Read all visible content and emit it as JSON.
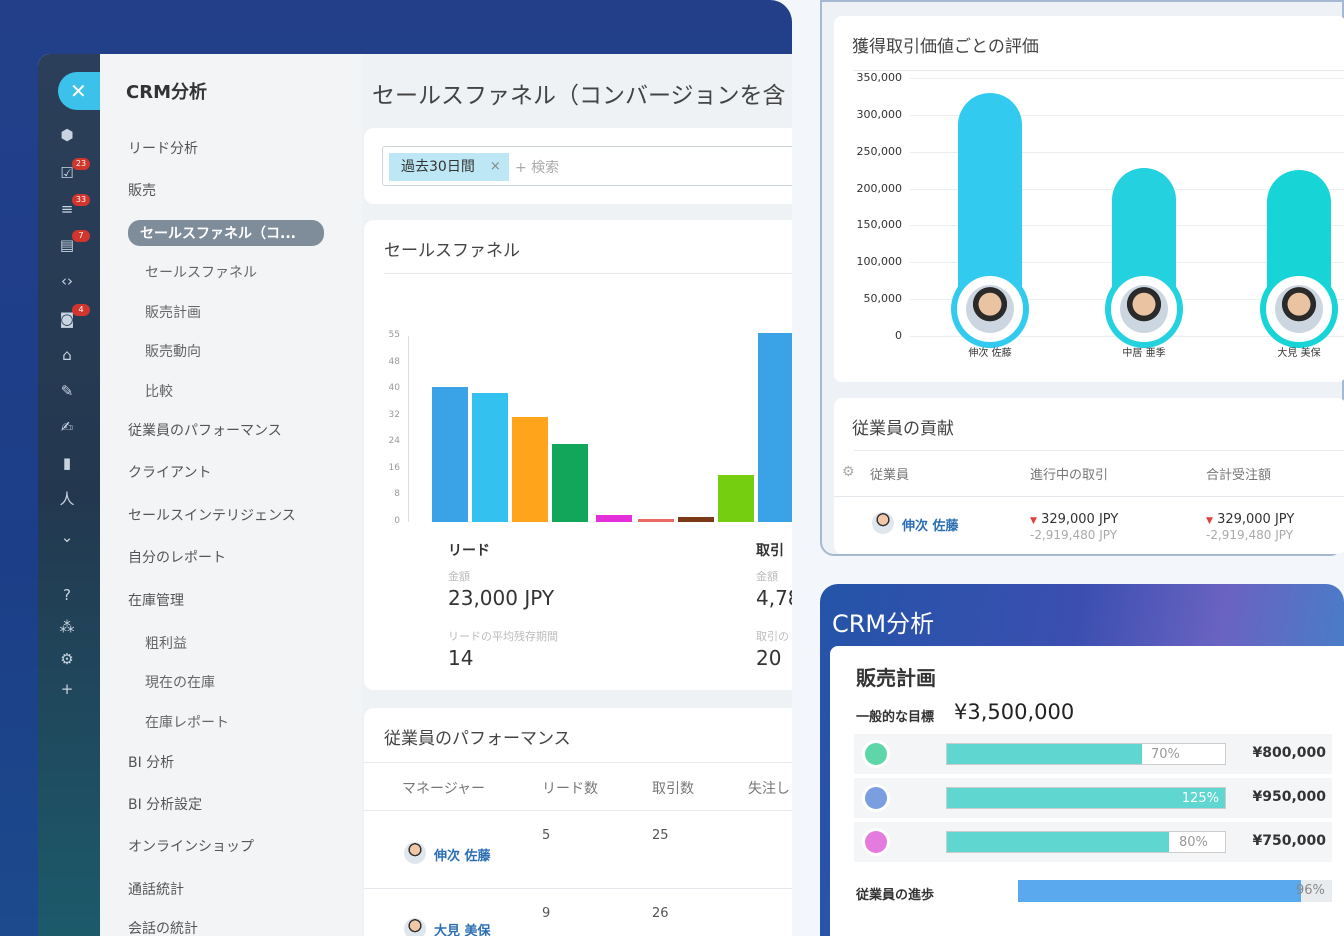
{
  "menu": {
    "title": "CRM分析",
    "items": [
      {
        "label": "リード分析"
      },
      {
        "label": "販売"
      },
      {
        "label": "セールスファネル（コ..."
      },
      {
        "label": "セールスファネル"
      },
      {
        "label": "販売計画"
      },
      {
        "label": "販売動向"
      },
      {
        "label": "比較"
      },
      {
        "label": "従業員のパフォーマンス"
      },
      {
        "label": "クライアント"
      },
      {
        "label": "セールスインテリジェンス"
      },
      {
        "label": "自分のレポート"
      },
      {
        "label": "在庫管理"
      },
      {
        "label": "粗利益"
      },
      {
        "label": "現在の在庫"
      },
      {
        "label": "在庫レポート"
      },
      {
        "label": "BI 分析"
      },
      {
        "label": "BI 分析設定"
      },
      {
        "label": "オンラインショップ"
      },
      {
        "label": "通話統計"
      },
      {
        "label": "会話の統計"
      }
    ]
  },
  "iconbar": {
    "close_icon": "✕",
    "badges": [
      "23",
      "33",
      "7",
      "4"
    ]
  },
  "main": {
    "title": "セールスファネル（コンバージョンを含",
    "filter": {
      "chip": "過去30日間",
      "chip_close": "×",
      "search_placeholder": "+ 検索"
    },
    "funnel": {
      "title": "セールスファネル",
      "leads": {
        "label": "リード",
        "amount_label": "金額",
        "amount": "23,000 JPY",
        "avg_label": "リードの平均残存期間",
        "avg": "14"
      },
      "deals": {
        "label": "取引",
        "amount_label": "金額",
        "amount": "4,78",
        "avg_label": "取引の",
        "avg": "20"
      }
    },
    "performance": {
      "title": "従業員のパフォーマンス",
      "columns": [
        "マネージャー",
        "リード数",
        "取引数",
        "失注し"
      ],
      "rows": [
        {
          "name": "伸次 佐藤",
          "leads": "5",
          "deals": "25"
        },
        {
          "name": "大見 美保",
          "leads": "9",
          "deals": "26"
        }
      ]
    }
  },
  "chart_data": [
    {
      "type": "bar",
      "ylim": [
        0,
        55
      ],
      "yticks": [
        "55",
        "48",
        "40",
        "32",
        "24",
        "16",
        "8",
        "0"
      ],
      "values": [
        40,
        38,
        31,
        23,
        2,
        1,
        1.5,
        14,
        56
      ],
      "colors": [
        "#3aa3e8",
        "#33c1f0",
        "#ffa41b",
        "#12a65b",
        "#e52fdb",
        "#e96b63",
        "#7a3a18",
        "#75cf10",
        "#3aa3e8"
      ]
    },
    {
      "type": "bar",
      "title": "獲得取引価値ごとの評価",
      "ylim": [
        0,
        350000
      ],
      "yticks": [
        "350,000",
        "300,000",
        "250,000",
        "200,000",
        "150,000",
        "100,000",
        "50,000",
        "0"
      ],
      "categories": [
        "伸次 佐藤",
        "中居 亜季",
        "大見 美保"
      ],
      "values": [
        329000,
        228000,
        225000
      ],
      "colors": [
        "#32cbef",
        "#24d1df",
        "#17d4d6"
      ]
    }
  ],
  "contrib": {
    "title": "従業員の貢献",
    "columns": [
      "従業員",
      "進行中の取引",
      "合計受注額"
    ],
    "row": {
      "name": "伸次 佐藤",
      "progress": "329,000 JPY",
      "progress_sub": "-2,919,480 JPY",
      "total": "329,000 JPY",
      "total_sub": "-2,919,480 JPY"
    }
  },
  "plan": {
    "banner": "CRM分析",
    "title": "販売計画",
    "goal_label": "一般的な目標",
    "goal_value": "¥3,500,000",
    "rows": [
      {
        "pct": "70%",
        "fraction": 0.7,
        "amount": "¥800,000",
        "color": "#5fd6a9"
      },
      {
        "pct": "125%",
        "fraction": 1.0,
        "amount": "¥950,000",
        "color": "#7b9ee0"
      },
      {
        "pct": "80%",
        "fraction": 0.8,
        "amount": "¥750,000",
        "color": "#e47ce0"
      }
    ],
    "progress_label": "従業員の進歩",
    "progress_pct": "96%",
    "progress_fraction": 0.9
  }
}
